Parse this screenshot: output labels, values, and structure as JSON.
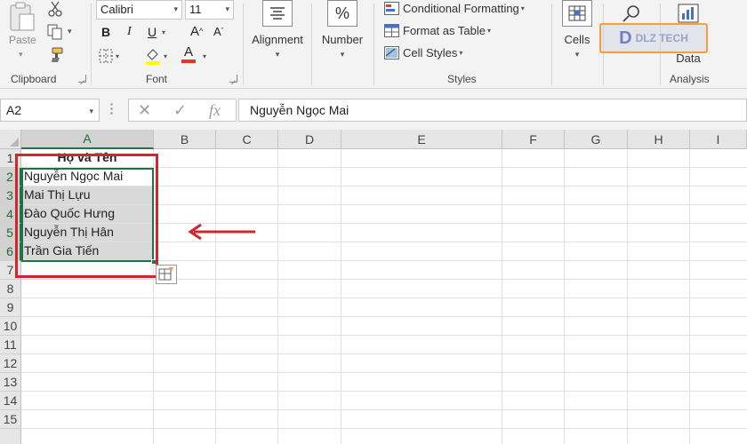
{
  "ribbon": {
    "clipboard": {
      "paste_label": "Paste",
      "group_label": "Clipboard"
    },
    "font": {
      "font_name": "Calibri",
      "font_size": "11",
      "bold_label": "B",
      "italic_label": "I",
      "underline_label": "U",
      "font_color_label": "A",
      "group_label": "Font"
    },
    "alignment": {
      "label": "Alignment"
    },
    "number": {
      "label": "Number",
      "icon_text": "%"
    },
    "styles": {
      "items": [
        "Conditional Formatting",
        "Format as Table",
        "Cell Styles"
      ],
      "group_label": "Styles"
    },
    "cells": {
      "label": "Cells"
    },
    "analysis": {
      "label": "Data",
      "group_label": "Analysis"
    },
    "logo_text": "DLZ TECH"
  },
  "formula_bar": {
    "name_box": "A2",
    "fx_label": "fx",
    "content": "Nguyễn Ngọc Mai"
  },
  "grid": {
    "columns": [
      "A",
      "B",
      "C",
      "D",
      "E",
      "F",
      "G",
      "H",
      "I"
    ],
    "rows": [
      "1",
      "2",
      "3",
      "4",
      "5",
      "6",
      "7",
      "8",
      "9",
      "10",
      "11",
      "12",
      "13",
      "14",
      "15"
    ],
    "column_a": [
      "Họ và Tên",
      "Nguyễn Ngọc Mai",
      "Mai Thị Lựu",
      "Đào Quốc Hưng",
      "Nguyễn Thị Hân",
      "Trần Gia Tiến"
    ]
  },
  "colors": {
    "excel_green": "#217346",
    "annotation_red": "#d0262c",
    "selection_shade": "#d9d9d9"
  },
  "icons": [
    "paste-icon",
    "cut-icon",
    "copy-icon",
    "format-painter-icon",
    "borders-icon",
    "fill-color-icon",
    "font-color-icon",
    "increase-font-icon",
    "decrease-font-icon",
    "alignment-icon",
    "percent-icon",
    "conditional-formatting-icon",
    "format-as-table-icon",
    "cell-styles-icon",
    "cells-icon",
    "search-icon",
    "cancel-icon",
    "enter-icon",
    "fx-icon",
    "autofill-options-icon",
    "red-arrow-annotation"
  ]
}
